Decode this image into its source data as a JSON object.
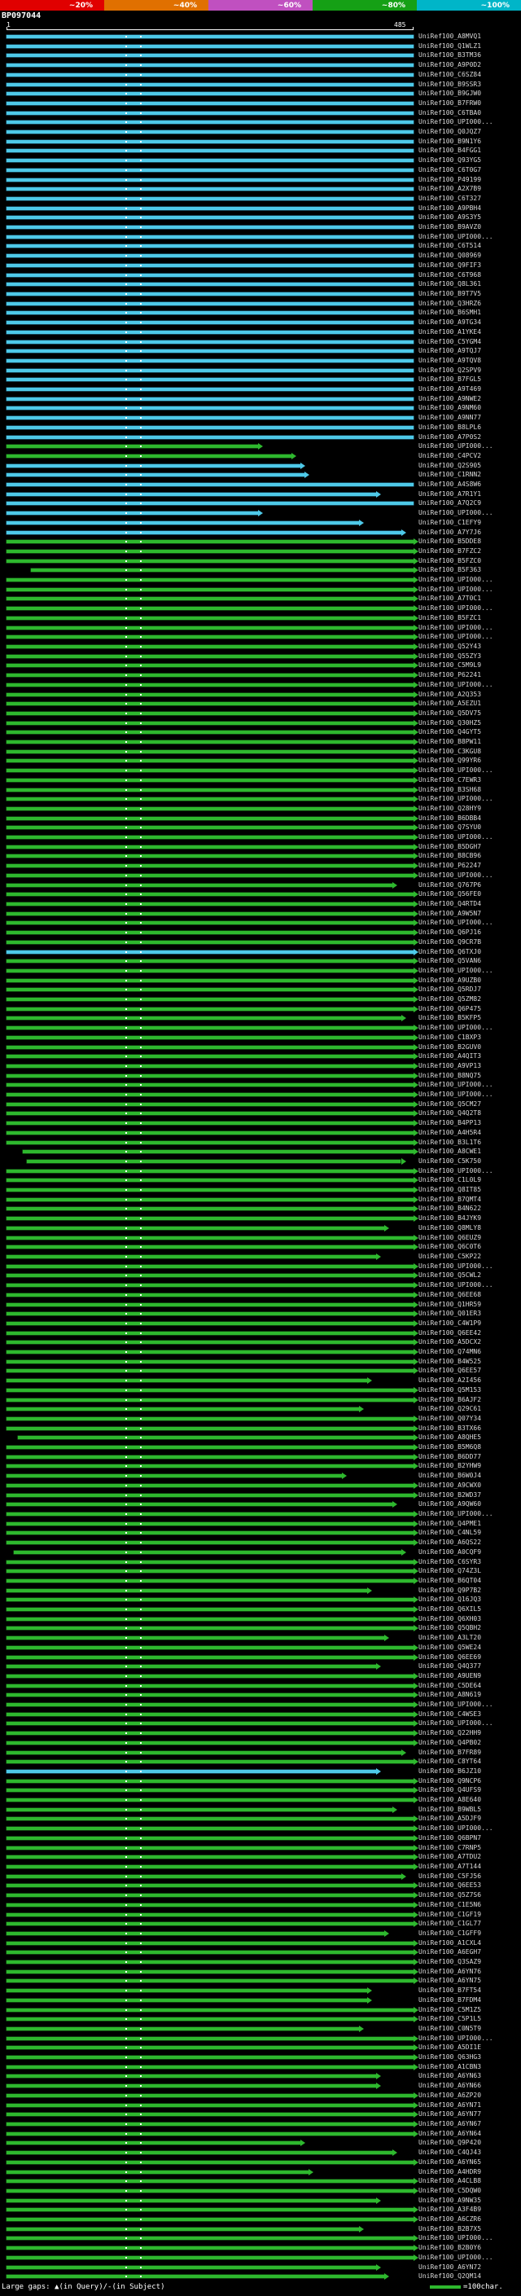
{
  "chart_data": {
    "type": "bar",
    "title": "BP097044",
    "x_axis": {
      "start_label": "1",
      "end_label": "485",
      "min": 1,
      "max": 485
    },
    "legend": {
      "identity_key": [
        {
          "label": "~20%",
          "color": "#e00000"
        },
        {
          "label": "~40%",
          "color": "#e07000"
        },
        {
          "label": "~60%",
          "color": "#c050c0"
        },
        {
          "label": "~80%",
          "color": "#15a015"
        },
        {
          "label": "~100%",
          "color": "#00b5c8"
        }
      ]
    },
    "row_defaults": {
      "label_prefix": "UniRef100_",
      "color": "green",
      "start": 1,
      "end": 485,
      "arrow": true,
      "dots": [
        142,
        160
      ]
    },
    "rows": [
      {
        "label": "A8MVQ1",
        "color": "cyan",
        "arrow": false
      },
      {
        "label": "Q1WLZ1",
        "color": "cyan",
        "arrow": false
      },
      {
        "label": "B3TM36",
        "color": "cyan",
        "arrow": false
      },
      {
        "label": "A9P0D2",
        "color": "cyan",
        "arrow": false
      },
      {
        "label": "C6SZ84",
        "color": "cyan",
        "arrow": false
      },
      {
        "label": "B9SSR3",
        "color": "cyan",
        "arrow": false
      },
      {
        "label": "B9GJW0",
        "color": "cyan",
        "arrow": false
      },
      {
        "label": "B7FRW0",
        "color": "cyan",
        "arrow": false
      },
      {
        "label": "C6TBA0",
        "color": "cyan",
        "arrow": false
      },
      {
        "label": "UPI000...",
        "color": "cyan",
        "arrow": false
      },
      {
        "label": "Q0JQZ7",
        "color": "cyan",
        "arrow": false
      },
      {
        "label": "B9N1Y6",
        "color": "cyan",
        "arrow": false
      },
      {
        "label": "B4FGG1",
        "color": "cyan",
        "arrow": false
      },
      {
        "label": "Q93YG5",
        "color": "cyan",
        "arrow": false
      },
      {
        "label": "C6T0G7",
        "color": "cyan",
        "arrow": false
      },
      {
        "label": "P49199",
        "color": "cyan",
        "arrow": false
      },
      {
        "label": "A2X7B9",
        "color": "cyan",
        "arrow": false
      },
      {
        "label": "C6T327",
        "color": "cyan",
        "arrow": false
      },
      {
        "label": "A9PBH4",
        "color": "cyan",
        "arrow": false
      },
      {
        "label": "A9S3Y5",
        "color": "cyan",
        "arrow": false
      },
      {
        "label": "B9AVZ0",
        "color": "cyan",
        "arrow": false
      },
      {
        "label": "UPI000...",
        "color": "cyan",
        "arrow": false
      },
      {
        "label": "C6T514",
        "color": "cyan",
        "arrow": false
      },
      {
        "label": "Q08969",
        "color": "cyan",
        "arrow": false
      },
      {
        "label": "Q9FIF3",
        "color": "cyan",
        "arrow": false
      },
      {
        "label": "C6T968",
        "color": "cyan",
        "arrow": false
      },
      {
        "label": "Q8L361",
        "color": "cyan",
        "arrow": false
      },
      {
        "label": "B9T7V5",
        "color": "cyan",
        "arrow": false
      },
      {
        "label": "Q3HRZ6",
        "color": "cyan",
        "arrow": false
      },
      {
        "label": "B6SMH1",
        "color": "cyan",
        "arrow": false
      },
      {
        "label": "A9TG34",
        "color": "cyan",
        "arrow": false
      },
      {
        "label": "A1YKE4",
        "color": "cyan",
        "arrow": false
      },
      {
        "label": "C5YGM4",
        "color": "cyan",
        "arrow": false
      },
      {
        "label": "A9TQJ7",
        "color": "cyan",
        "arrow": false
      },
      {
        "label": "A9TQV8",
        "color": "cyan",
        "arrow": false
      },
      {
        "label": "Q2SPV9",
        "color": "cyan",
        "arrow": false
      },
      {
        "label": "B7FGL5",
        "color": "cyan",
        "arrow": false
      },
      {
        "label": "A9T469",
        "color": "cyan",
        "arrow": false
      },
      {
        "label": "A9NWE2",
        "color": "cyan",
        "arrow": false
      },
      {
        "label": "A9NM60",
        "color": "cyan",
        "arrow": false
      },
      {
        "label": "A9NN77",
        "color": "cyan",
        "arrow": false
      },
      {
        "label": "B8LPL6",
        "color": "cyan",
        "arrow": false
      },
      {
        "label": "A7P0S2",
        "color": "cyan",
        "arrow": false
      },
      {
        "label": "UPI000...",
        "end": 300
      },
      {
        "label": "C4PCV2",
        "end": 340
      },
      {
        "label": "Q2S905",
        "color": "cyan",
        "end": 350
      },
      {
        "label": "C1RNN2",
        "color": "cyan",
        "end": 355
      },
      {
        "label": "A4S8W6",
        "color": "cyan",
        "arrow": false
      },
      {
        "label": "A7R1Y1",
        "color": "cyan",
        "end": 440
      },
      {
        "label": "A7Q2C9",
        "color": "cyan",
        "arrow": false
      },
      {
        "label": "UPI000...",
        "color": "cyan",
        "end": 300
      },
      {
        "label": "C1EFY9",
        "color": "cyan",
        "end": 420
      },
      {
        "label": "A7Y7J6",
        "color": "cyan",
        "end": 470
      },
      {
        "label": "B5DDE8"
      },
      {
        "label": "B7FZC2"
      },
      {
        "label": "B5FZC0"
      },
      {
        "label": "B5F363",
        "start": 30
      },
      {
        "label": "UPI000..."
      },
      {
        "label": "UPI000..."
      },
      {
        "label": "A7T0C1"
      },
      {
        "label": "UPI000..."
      },
      {
        "label": "B5FZC1"
      },
      {
        "label": "UPI000..."
      },
      {
        "label": "UPI000..."
      },
      {
        "label": "Q52Y43"
      },
      {
        "label": "Q55ZY3"
      },
      {
        "label": "C5M9L9"
      },
      {
        "label": "P62241"
      },
      {
        "label": "UPI000..."
      },
      {
        "label": "A2Q353"
      },
      {
        "label": "A5EZU1"
      },
      {
        "label": "Q5DV75"
      },
      {
        "label": "Q30HZ5"
      },
      {
        "label": "Q4GYT5"
      },
      {
        "label": "B8PW11"
      },
      {
        "label": "C3KGU8"
      },
      {
        "label": "Q99YR6"
      },
      {
        "label": "UPI000..."
      },
      {
        "label": "C7EWR3"
      },
      {
        "label": "B3SH68"
      },
      {
        "label": "UPI000..."
      },
      {
        "label": "Q28HY9"
      },
      {
        "label": "B6DBB4"
      },
      {
        "label": "Q7SYU0"
      },
      {
        "label": "UPI000..."
      },
      {
        "label": "B5DGH7"
      },
      {
        "label": "B8CB96"
      },
      {
        "label": "P62247"
      },
      {
        "label": "UPI000..."
      },
      {
        "label": "Q767P6",
        "end": 460
      },
      {
        "label": "Q56FE0"
      },
      {
        "label": "Q4RTD4"
      },
      {
        "label": "A9W5N7"
      },
      {
        "label": "UPI000..."
      },
      {
        "label": "Q6PJ16"
      },
      {
        "label": "Q9CR7B"
      },
      {
        "label": "Q6TXJ0",
        "color": "cyan"
      },
      {
        "label": "Q5VAN6"
      },
      {
        "label": "UPI000..."
      },
      {
        "label": "A9UZB0"
      },
      {
        "label": "Q5RDJ7"
      },
      {
        "label": "Q5ZM82"
      },
      {
        "label": "Q6P475"
      },
      {
        "label": "B5KFP5",
        "end": 470
      },
      {
        "label": "UPI000..."
      },
      {
        "label": "C1BXP3"
      },
      {
        "label": "B2GUV0"
      },
      {
        "label": "A4QIT3"
      },
      {
        "label": "A9VP13"
      },
      {
        "label": "B8NQ75"
      },
      {
        "label": "UPI000..."
      },
      {
        "label": "UPI000..."
      },
      {
        "label": "Q5CM27"
      },
      {
        "label": "Q4Q2T8"
      },
      {
        "label": "B4PP13"
      },
      {
        "label": "A4H5R4"
      },
      {
        "label": "B3L1T6"
      },
      {
        "label": "A8CWE1",
        "start": 20
      },
      {
        "label": "C5K750",
        "start": 25,
        "end": 470
      },
      {
        "label": "UPI000..."
      },
      {
        "label": "C1L0L9"
      },
      {
        "label": "Q8IT85"
      },
      {
        "label": "B7QMT4"
      },
      {
        "label": "B4N622"
      },
      {
        "label": "B4JYK9"
      },
      {
        "label": "Q8MLY8",
        "end": 450
      },
      {
        "label": "Q6EUZ9"
      },
      {
        "label": "Q6C0T6"
      },
      {
        "label": "C5KP22",
        "end": 440
      },
      {
        "label": "UPI000..."
      },
      {
        "label": "Q5CWL2"
      },
      {
        "label": "UPI000..."
      },
      {
        "label": "Q6EE68"
      },
      {
        "label": "Q1HR59"
      },
      {
        "label": "Q01ER3"
      },
      {
        "label": "C4W1P9"
      },
      {
        "label": "Q6EE42"
      },
      {
        "label": "A5DCX2"
      },
      {
        "label": "Q74MN6"
      },
      {
        "label": "B4W525"
      },
      {
        "label": "Q6EE57"
      },
      {
        "label": "A2I456",
        "end": 430
      },
      {
        "label": "Q5M153"
      },
      {
        "label": "B6AJF2"
      },
      {
        "label": "Q29C61",
        "end": 420
      },
      {
        "label": "Q07Y34"
      },
      {
        "label": "B3TX66"
      },
      {
        "label": "A8QHE5",
        "start": 15
      },
      {
        "label": "B5M6Q8"
      },
      {
        "label": "B6DD77"
      },
      {
        "label": "B2YHW9"
      },
      {
        "label": "B6W0J4",
        "end": 400
      },
      {
        "label": "A9CWX0"
      },
      {
        "label": "B2WD37"
      },
      {
        "label": "A9QW60",
        "end": 460
      },
      {
        "label": "UPI000..."
      },
      {
        "label": "Q4PME1"
      },
      {
        "label": "C4NL59"
      },
      {
        "label": "A6QS22"
      },
      {
        "label": "A0CQF9",
        "start": 10,
        "end": 470
      },
      {
        "label": "C6SYR3"
      },
      {
        "label": "Q74Z3L"
      },
      {
        "label": "B6QT04"
      },
      {
        "label": "Q9P7B2",
        "end": 430
      },
      {
        "label": "Q16JQ3"
      },
      {
        "label": "Q6XIL5"
      },
      {
        "label": "Q6XH03"
      },
      {
        "label": "Q5QBH2"
      },
      {
        "label": "A3LT20",
        "end": 450
      },
      {
        "label": "Q5WE24"
      },
      {
        "label": "Q6EE69"
      },
      {
        "label": "Q4Q377",
        "end": 440
      },
      {
        "label": "A9UEN9"
      },
      {
        "label": "C5DE64"
      },
      {
        "label": "A8N619"
      },
      {
        "label": "UPI000..."
      },
      {
        "label": "C4WSE3"
      },
      {
        "label": "UPI000..."
      },
      {
        "label": "Q22HH9"
      },
      {
        "label": "Q4PB02"
      },
      {
        "label": "B7FR89",
        "end": 470
      },
      {
        "label": "C8YT64"
      },
      {
        "label": "B6JZ10",
        "color": "cyan",
        "end": 440
      },
      {
        "label": "Q9NCP6"
      },
      {
        "label": "Q4UFS9"
      },
      {
        "label": "A8E640"
      },
      {
        "label": "B9WBL5",
        "end": 460
      },
      {
        "label": "A5DJF9"
      },
      {
        "label": "UPI000..."
      },
      {
        "label": "Q6BPN7"
      },
      {
        "label": "C7RNP5"
      },
      {
        "label": "A7TDU2"
      },
      {
        "label": "A7T144"
      },
      {
        "label": "C5FJ56",
        "end": 470
      },
      {
        "label": "Q6EE53"
      },
      {
        "label": "Q5Z7S6"
      },
      {
        "label": "C1E5N6"
      },
      {
        "label": "C1GF19"
      },
      {
        "label": "C1GL77"
      },
      {
        "label": "C1GFF9",
        "end": 450
      },
      {
        "label": "A1CXL4"
      },
      {
        "label": "A6EGH7"
      },
      {
        "label": "Q3SAZ9"
      },
      {
        "label": "A6YN76"
      },
      {
        "label": "A6YN75"
      },
      {
        "label": "B7FT54",
        "end": 430
      },
      {
        "label": "B7FDM4",
        "end": 430
      },
      {
        "label": "C5M1Z5"
      },
      {
        "label": "C5P1L5"
      },
      {
        "label": "C0N5T9",
        "end": 420
      },
      {
        "label": "UPI000..."
      },
      {
        "label": "A5DI1E"
      },
      {
        "label": "Q63HG3"
      },
      {
        "label": "A1CBN3"
      },
      {
        "label": "A6YN63",
        "end": 440
      },
      {
        "label": "A6YN66",
        "end": 440
      },
      {
        "label": "A6ZP20"
      },
      {
        "label": "A6YN71"
      },
      {
        "label": "A6YN77"
      },
      {
        "label": "A6YN67"
      },
      {
        "label": "A6YN64"
      },
      {
        "label": "Q9P420",
        "end": 350
      },
      {
        "label": "C4QJ43",
        "end": 460
      },
      {
        "label": "A6YN65"
      },
      {
        "label": "A4HDR9",
        "end": 360
      },
      {
        "label": "A4CLB8"
      },
      {
        "label": "C5DQW0"
      },
      {
        "label": "A9NW35",
        "end": 440
      },
      {
        "label": "A3F4B9"
      },
      {
        "label": "A6CZR6"
      },
      {
        "label": "B2B7X5",
        "end": 420
      },
      {
        "label": "UPI000..."
      },
      {
        "label": "B2B0Y6"
      },
      {
        "label": "UPI000..."
      },
      {
        "label": "A6YN72",
        "end": 440
      },
      {
        "label": "Q2QM14",
        "end": 450
      }
    ]
  },
  "footer": {
    "gaps_legend": "Large gaps: ▲(in Query)/-(in Subject)",
    "scale_legend": "=100char."
  }
}
